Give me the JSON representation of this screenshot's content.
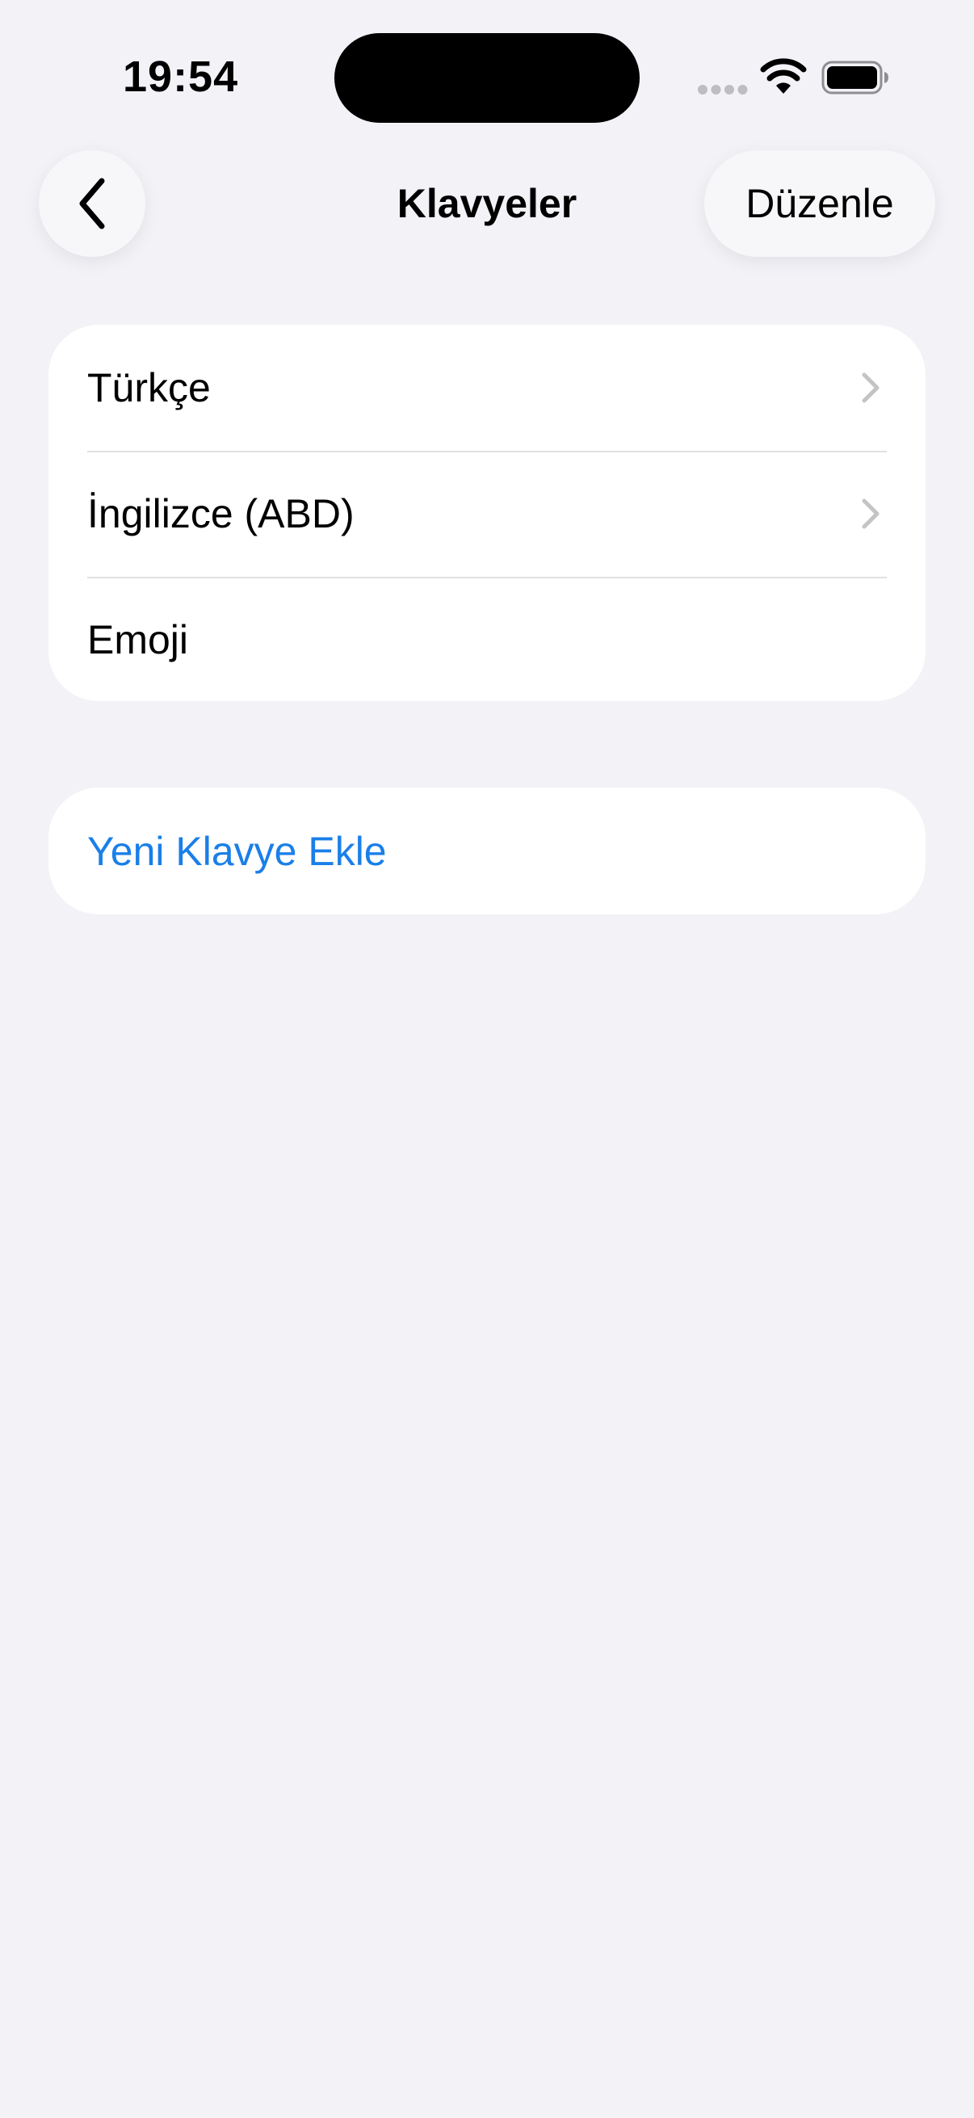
{
  "status_bar": {
    "time": "19:54"
  },
  "nav": {
    "title": "Klavyeler",
    "back_icon": "chevron-left-icon",
    "edit_label": "Düzenle"
  },
  "keyboards": {
    "items": [
      {
        "label": "Türkçe",
        "has_chevron": true
      },
      {
        "label": "İngilizce (ABD)",
        "has_chevron": true
      },
      {
        "label": "Emoji",
        "has_chevron": false
      }
    ]
  },
  "add_keyboard": {
    "label": "Yeni Klavye Ekle"
  },
  "colors": {
    "background": "#F2F2F7",
    "card": "#FFFFFF",
    "link": "#1A7FE8",
    "separator": "#E0E0E5",
    "chevron": "#C4C4C7"
  }
}
